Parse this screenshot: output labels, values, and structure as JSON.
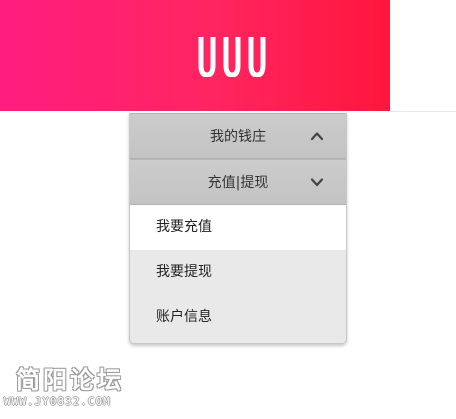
{
  "header": {
    "logo_text": "UUU",
    "background_gradient": [
      "#ff1d7f",
      "#ff163c"
    ]
  },
  "menu": {
    "sections": [
      {
        "label": "我的钱庄",
        "icon": "chevron-up-icon"
      },
      {
        "label": "充值|提现",
        "icon": "chevron-down-icon"
      }
    ],
    "items": [
      {
        "label": "我要充值",
        "active": true
      },
      {
        "label": "我要提现",
        "active": false
      },
      {
        "label": "账户信息",
        "active": false
      }
    ]
  },
  "watermark": {
    "site_name": "简阳论坛",
    "url": "WWW.JY0832.COM"
  }
}
